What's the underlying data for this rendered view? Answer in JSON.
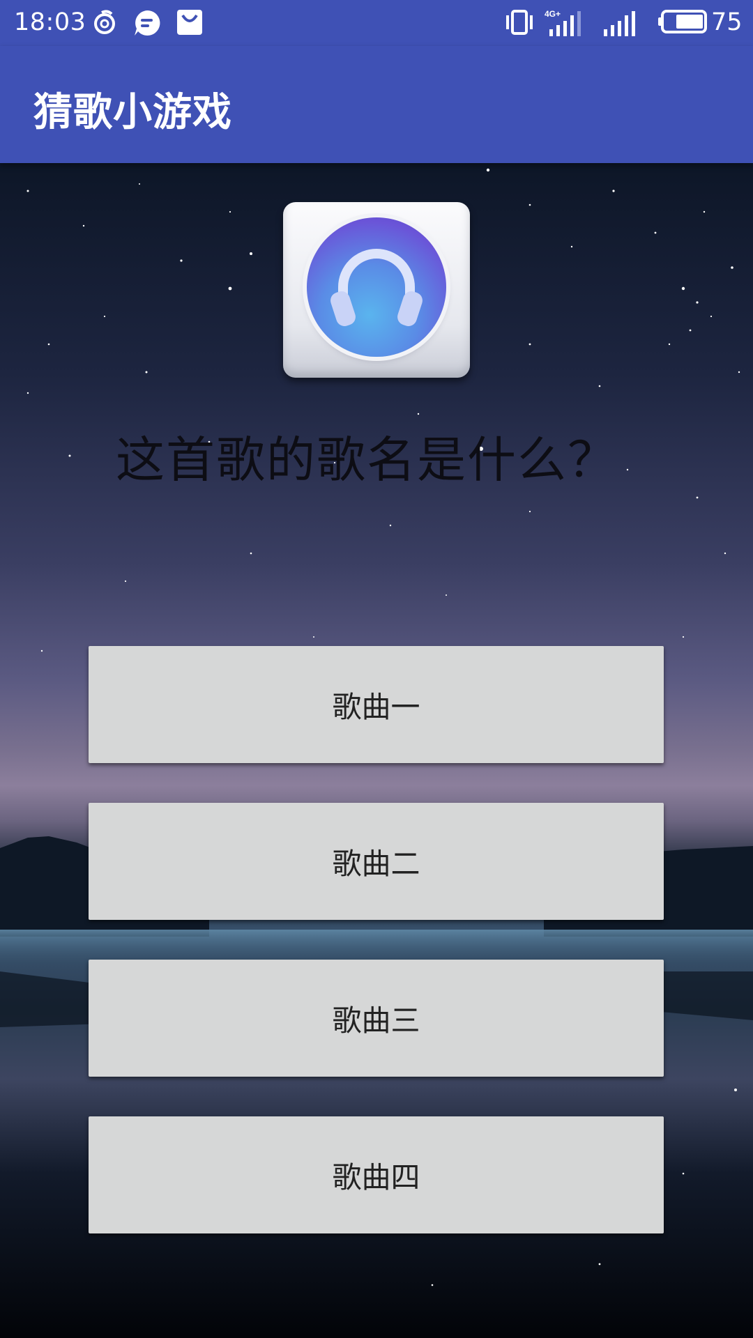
{
  "status_bar": {
    "time": "18:03",
    "network": "4G",
    "battery": "75",
    "icons": [
      "netease-music-icon",
      "message-icon",
      "shopping-bag-icon",
      "vibrate-icon",
      "signal-4g-icon",
      "signal-icon",
      "battery-icon"
    ]
  },
  "app_bar": {
    "title": "猜歌小游戏"
  },
  "quiz": {
    "question": "这首歌的歌名是什么？",
    "cover_icon": "headphones-icon",
    "options": [
      "歌曲一",
      "歌曲二",
      "歌曲三",
      "歌曲四"
    ]
  },
  "colors": {
    "primary": "#3f51b5",
    "button_bg": "#d6d7d7",
    "button_text": "#222222"
  }
}
